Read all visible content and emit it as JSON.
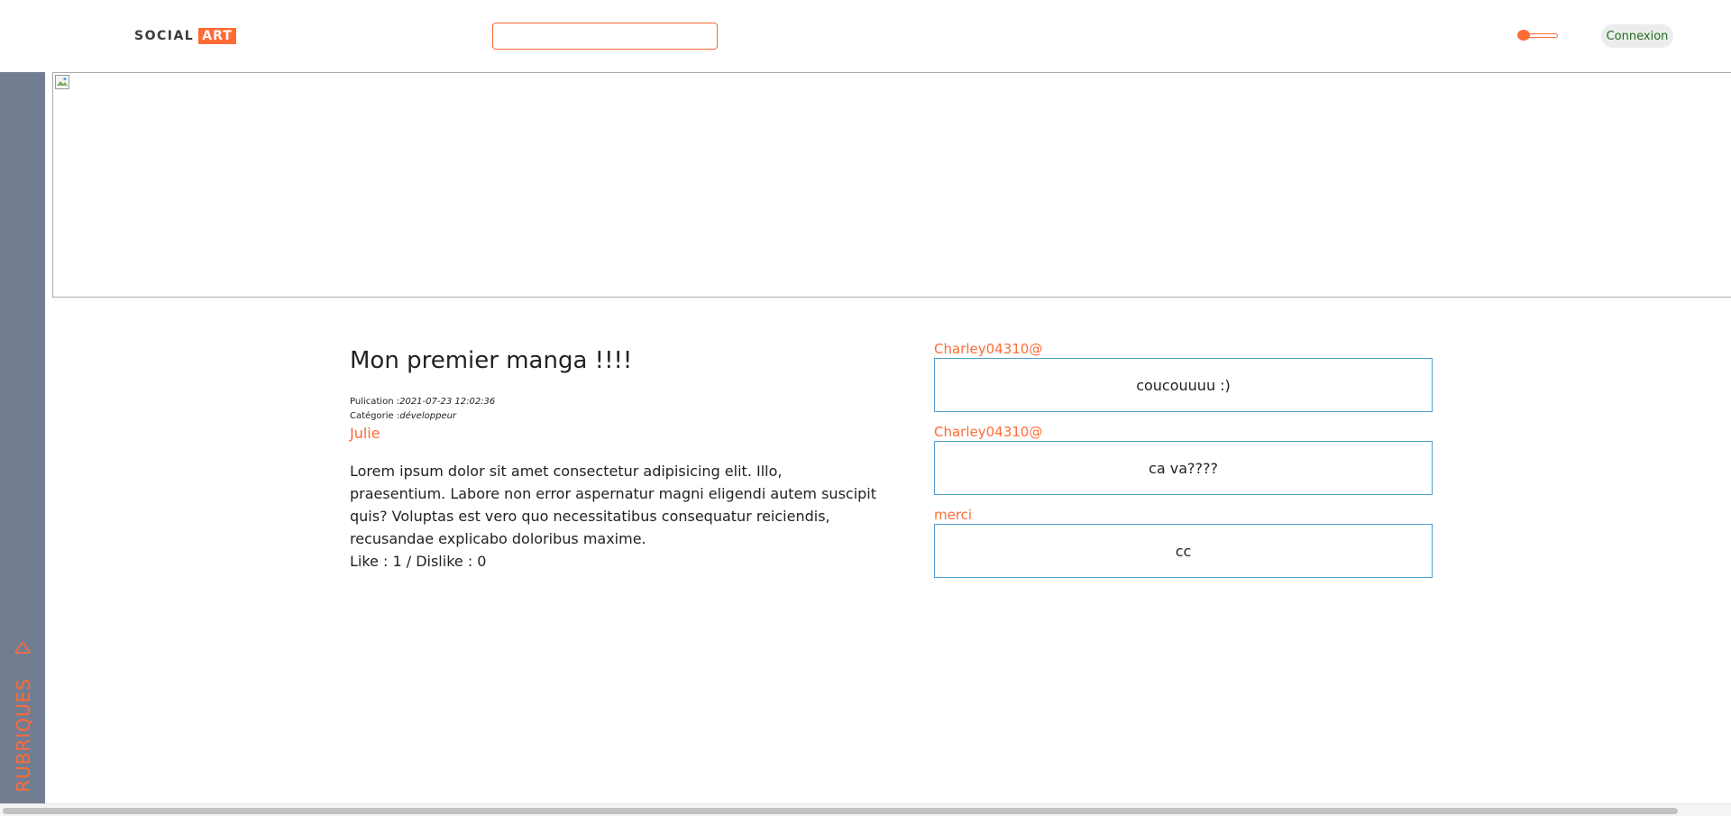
{
  "header": {
    "logo_social": "SOCIAL",
    "logo_art": "ART",
    "search": {
      "value": "",
      "placeholder": ""
    },
    "login_label": "Connexion"
  },
  "colors": {
    "accent": "#ff6b35",
    "sidebar": "#737d92",
    "comment_border": "#4f9fd4",
    "login_text": "#1d6e1d"
  },
  "sidebar": {
    "label": "RUBRIQUES",
    "icon": "triangle-up-outline-icon"
  },
  "banner": {
    "icon": "broken-image-icon"
  },
  "article": {
    "title": "Mon premier manga !!!!",
    "publication_label": "Pulication :",
    "publication_value": "2021-07-23 12:02:36",
    "category_label": "Catégorie :",
    "category_value": "développeur",
    "author": "Julie",
    "body": "Lorem ipsum dolor sit amet consectetur adipisicing elit. Illo, praesentium. Labore non error aspernatur magni eligendi autem suscipit quis? Voluptas est vero quo necessitatibus consequatur reiciendis, recusandae explicabo doloribus maxime.",
    "reactions": "Like : 1 / Dislike : 0"
  },
  "comments": [
    {
      "author": "Charley04310@",
      "text": "coucouuuu :)"
    },
    {
      "author": "Charley04310@",
      "text": "ca va????"
    },
    {
      "author": "merci",
      "text": "cc"
    }
  ]
}
